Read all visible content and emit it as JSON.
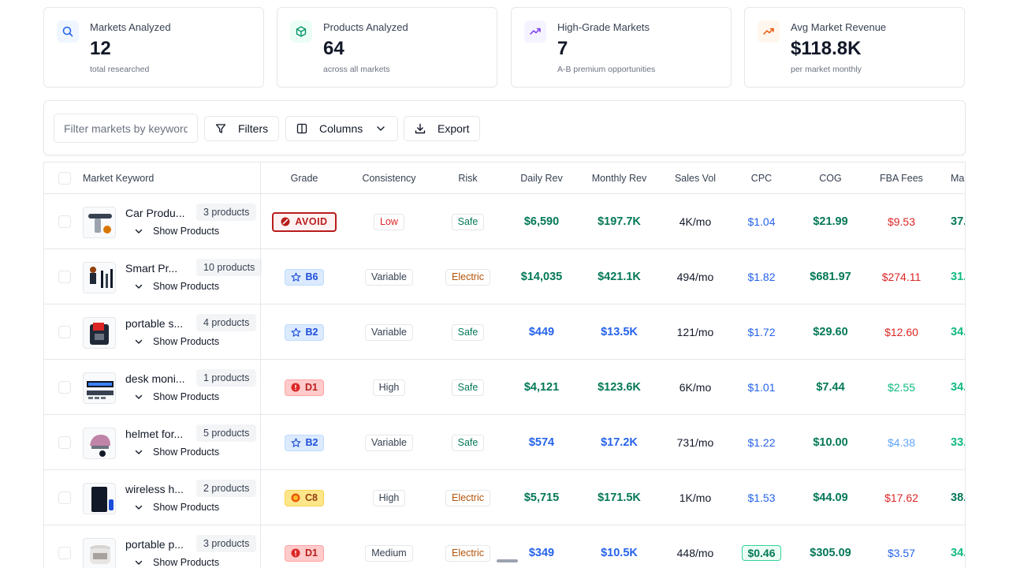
{
  "cards": [
    {
      "label": "Markets Analyzed",
      "value": "12",
      "sub": "total researched",
      "icon": "search-icon",
      "accent": "#2563eb",
      "bg": "#eff6ff"
    },
    {
      "label": "Products Analyzed",
      "value": "64",
      "sub": "across all markets",
      "icon": "box-icon",
      "accent": "#059669",
      "bg": "#ecfdf5"
    },
    {
      "label": "High-Grade Markets",
      "value": "7",
      "sub": "A-B premium opportunities",
      "icon": "trending-up-icon",
      "accent": "#7c3aed",
      "bg": "#f5f3ff"
    },
    {
      "label": "Avg Market Revenue",
      "value": "$118.8K",
      "sub": "per market monthly",
      "icon": "trending-up-icon",
      "accent": "#ea580c",
      "bg": "#fff7ed"
    }
  ],
  "toolbar": {
    "filter_placeholder": "Filter markets by keyword...",
    "filters_label": "Filters",
    "columns_label": "Columns",
    "export_label": "Export"
  },
  "table": {
    "headers": {
      "keyword": "Market Keyword",
      "grade": "Grade",
      "consistency": "Consistency",
      "risk": "Risk",
      "daily": "Daily Rev",
      "monthly": "Monthly Rev",
      "sales": "Sales Vol",
      "cpc": "CPC",
      "cog": "COG",
      "fba": "FBA Fees",
      "margin": "Ma"
    },
    "show_products_label": "Show Products",
    "rows": [
      {
        "keyword": "Car Produ...",
        "products": "3 products",
        "grade": "AVOID",
        "grade_type": "avoid",
        "consistency": "Low",
        "risk": "Safe",
        "daily": "$6,590",
        "monthly": "$197.7K",
        "sales": "4K/mo",
        "cpc": "$1.04",
        "cpc_hl": false,
        "cog": "$21.99",
        "fba": "$9.53",
        "margin": "37.",
        "rev_color": "#047857",
        "fba_color": "#dc2626",
        "margin_color": "#047857"
      },
      {
        "keyword": "Smart Pr...",
        "products": "10 products",
        "grade": "B6",
        "grade_type": "b",
        "consistency": "Variable",
        "risk": "Electric",
        "daily": "$14,035",
        "monthly": "$421.1K",
        "sales": "494/mo",
        "cpc": "$1.82",
        "cpc_hl": false,
        "cog": "$681.97",
        "fba": "$274.11",
        "margin": "31.",
        "rev_color": "#047857",
        "fba_color": "#dc2626",
        "margin_color": "#10b981"
      },
      {
        "keyword": "portable s...",
        "products": "4 products",
        "grade": "B2",
        "grade_type": "b",
        "consistency": "Variable",
        "risk": "Safe",
        "daily": "$449",
        "monthly": "$13.5K",
        "sales": "121/mo",
        "cpc": "$1.72",
        "cpc_hl": false,
        "cog": "$29.60",
        "fba": "$12.60",
        "margin": "34.",
        "rev_color": "#2563eb",
        "fba_color": "#dc2626",
        "margin_color": "#10b981"
      },
      {
        "keyword": "desk moni...",
        "products": "1 products",
        "grade": "D1",
        "grade_type": "d",
        "consistency": "High",
        "risk": "Safe",
        "daily": "$4,121",
        "monthly": "$123.6K",
        "sales": "6K/mo",
        "cpc": "$1.01",
        "cpc_hl": false,
        "cog": "$7.44",
        "fba": "$2.55",
        "margin": "34.",
        "rev_color": "#047857",
        "fba_color": "#10b981",
        "margin_color": "#10b981"
      },
      {
        "keyword": "helmet for...",
        "products": "5 products",
        "grade": "B2",
        "grade_type": "b",
        "consistency": "Variable",
        "risk": "Safe",
        "daily": "$574",
        "monthly": "$17.2K",
        "sales": "731/mo",
        "cpc": "$1.22",
        "cpc_hl": false,
        "cog": "$10.00",
        "fba": "$4.38",
        "margin": "33.",
        "rev_color": "#2563eb",
        "fba_color": "#60a5fa",
        "margin_color": "#10b981"
      },
      {
        "keyword": "wireless h...",
        "products": "2 products",
        "grade": "C8",
        "grade_type": "c",
        "consistency": "High",
        "risk": "Electric",
        "daily": "$5,715",
        "monthly": "$171.5K",
        "sales": "1K/mo",
        "cpc": "$1.53",
        "cpc_hl": false,
        "cog": "$44.09",
        "fba": "$17.62",
        "margin": "38.",
        "rev_color": "#047857",
        "fba_color": "#dc2626",
        "margin_color": "#047857"
      },
      {
        "keyword": "portable p...",
        "products": "3 products",
        "grade": "D1",
        "grade_type": "d",
        "consistency": "Medium",
        "risk": "Electric",
        "daily": "$349",
        "monthly": "$10.5K",
        "sales": "448/mo",
        "cpc": "$0.46",
        "cpc_hl": true,
        "cog": "$305.09",
        "fba": "$3.57",
        "margin": "34.",
        "rev_color": "#2563eb",
        "fba_color": "#2563eb",
        "margin_color": "#10b981"
      }
    ]
  }
}
